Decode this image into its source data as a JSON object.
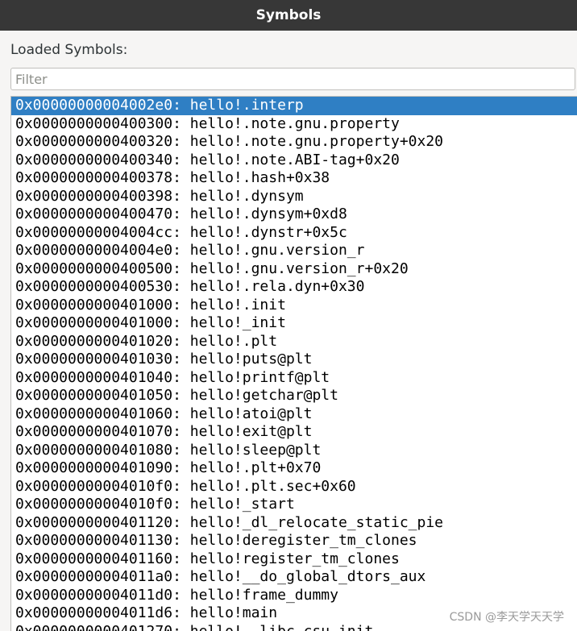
{
  "window": {
    "title": "Symbols"
  },
  "panel": {
    "label": "Loaded Symbols:",
    "filter_placeholder": "Filter",
    "filter_value": ""
  },
  "symbols": [
    "0x00000000004002e0: hello!.interp",
    "0x0000000000400300: hello!.note.gnu.property",
    "0x0000000000400320: hello!.note.gnu.property+0x20",
    "0x0000000000400340: hello!.note.ABI-tag+0x20",
    "0x0000000000400378: hello!.hash+0x38",
    "0x0000000000400398: hello!.dynsym",
    "0x0000000000400470: hello!.dynsym+0xd8",
    "0x00000000004004cc: hello!.dynstr+0x5c",
    "0x00000000004004e0: hello!.gnu.version_r",
    "0x0000000000400500: hello!.gnu.version_r+0x20",
    "0x0000000000400530: hello!.rela.dyn+0x30",
    "0x0000000000401000: hello!.init",
    "0x0000000000401000: hello!_init",
    "0x0000000000401020: hello!.plt",
    "0x0000000000401030: hello!puts@plt",
    "0x0000000000401040: hello!printf@plt",
    "0x0000000000401050: hello!getchar@plt",
    "0x0000000000401060: hello!atoi@plt",
    "0x0000000000401070: hello!exit@plt",
    "0x0000000000401080: hello!sleep@plt",
    "0x0000000000401090: hello!.plt+0x70",
    "0x00000000004010f0: hello!.plt.sec+0x60",
    "0x00000000004010f0: hello!_start",
    "0x0000000000401120: hello!_dl_relocate_static_pie",
    "0x0000000000401130: hello!deregister_tm_clones",
    "0x0000000000401160: hello!register_tm_clones",
    "0x00000000004011a0: hello!__do_global_dtors_aux",
    "0x00000000004011d0: hello!frame_dummy",
    "0x00000000004011d6: hello!main",
    "0x0000000000401270: hello!__libc_csu_init"
  ],
  "selected_index": 0,
  "colors": {
    "selection": "#2f7fc4",
    "titlebar": "#373737"
  },
  "watermark": "CSDN @李天学天天学"
}
